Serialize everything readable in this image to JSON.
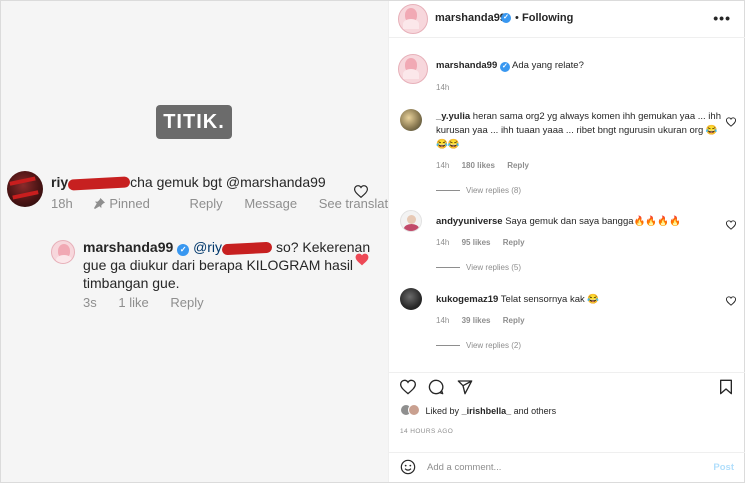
{
  "overlay": {
    "caption": "TITIK."
  },
  "screenshot_comments": {
    "main": {
      "username_visible": "riy",
      "username_tail": "cha",
      "text": "gemuk bgt",
      "mention": "@marshanda99",
      "time": "18h",
      "pinned": "Pinned",
      "reply": "Reply",
      "message": "Message",
      "see_translation": "See translation"
    },
    "reply": {
      "username": "marshanda99",
      "mention_prefix": "@riy",
      "mention_tail": "so?",
      "text": "Kekerenan gue ga diukur dari berapa KILOGRAM hasil timbangan gue.",
      "time": "3s",
      "likes": "1 like",
      "reply": "Reply"
    }
  },
  "post": {
    "header": {
      "username": "marshanda99",
      "separator": "•",
      "follow_state": "Following",
      "more": "•••"
    },
    "caption": {
      "username": "marshanda99",
      "text": "Ada yang relate?",
      "time": "14h"
    },
    "comments": [
      {
        "username": "_y.yulia",
        "text": "heran sama org2 yg always komen ihh gemukan yaa ... ihh kurusan yaa ... ihh tuaan yaaa ... ribet bngt ngurusin ukuran org 😂😂😂",
        "time": "14h",
        "likes": "180 likes",
        "reply": "Reply",
        "view_replies": "View replies (8)"
      },
      {
        "username": "andyyuniverse",
        "text": "Saya gemuk dan saya bangga🔥🔥🔥🔥",
        "time": "14h",
        "likes": "95 likes",
        "reply": "Reply",
        "view_replies": "View replies (5)"
      },
      {
        "username": "kukogemaz19",
        "text": "Telat sensornya kak 😂",
        "time": "14h",
        "likes": "39 likes",
        "reply": "Reply",
        "view_replies": "View replies (2)"
      }
    ],
    "liked_by": {
      "prefix": "Liked by",
      "user": "_irishbella_",
      "suffix": "and others"
    },
    "timestamp": "14 HOURS AGO",
    "add_comment": {
      "placeholder": "Add a comment...",
      "post_label": "Post"
    },
    "icons": [
      "heart-icon",
      "comment-icon",
      "share-icon",
      "bookmark-icon",
      "smile-icon",
      "more-icon",
      "verified-icon"
    ],
    "colors": {
      "verified": "#3897f0",
      "liked_heart": "#ed4956",
      "post_button": "#b2dffc",
      "mention": "#00376b",
      "redaction": "#c72020"
    }
  }
}
